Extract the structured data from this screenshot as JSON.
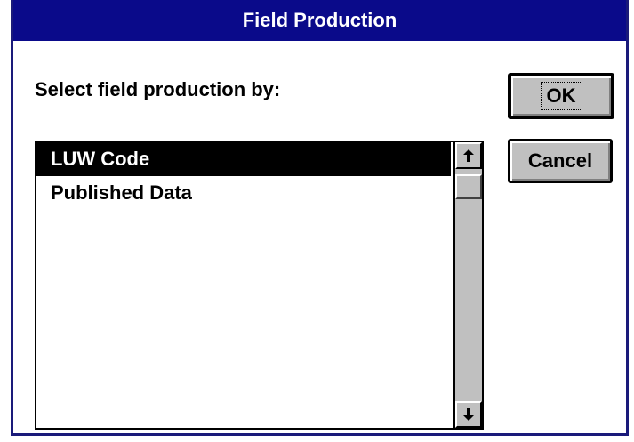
{
  "window": {
    "title": "Field Production"
  },
  "prompt": {
    "label": "Select field production by:"
  },
  "list": {
    "items": [
      {
        "label": "LUW Code",
        "selected": true
      },
      {
        "label": "Published Data",
        "selected": false
      }
    ]
  },
  "buttons": {
    "ok_label": "OK",
    "cancel_label": "Cancel"
  },
  "colors": {
    "titlebar": "#0a0a8a",
    "title_text": "#ffffff",
    "button_face": "#c0c0c0",
    "selection": "#000000"
  },
  "icons": {
    "scroll_up": "up-arrow-icon",
    "scroll_down": "down-arrow-icon"
  }
}
